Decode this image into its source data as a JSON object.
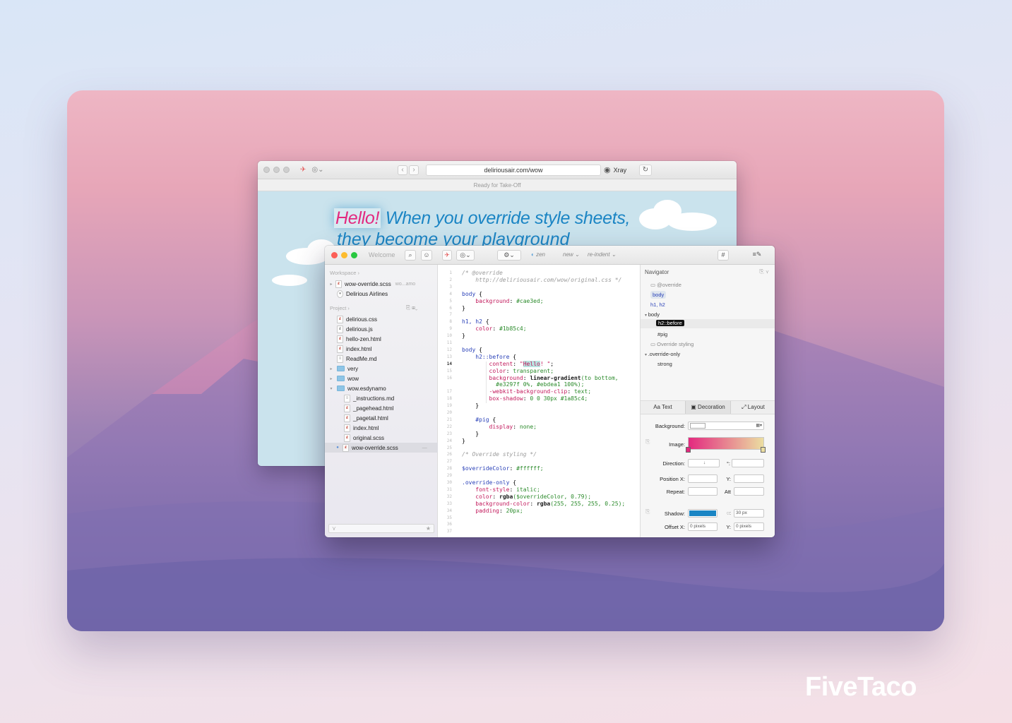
{
  "brand": "FiveTaco",
  "browser": {
    "url": "deliriousair.com/wow",
    "xray_label": "Xray",
    "status": "Ready for Take-Off",
    "headline_highlight": "Hello!",
    "headline_rest": " When you override style sheets,",
    "headline_line2": "they become your playground"
  },
  "editor": {
    "welcome": "Welcome",
    "toolbar": {
      "zen": "zen",
      "new": "new ⌄",
      "reindent": "re-indent ⌄",
      "hash": "#"
    },
    "sidebar": {
      "workspace_header": "Workspace ›",
      "workspace_items": [
        {
          "name": "wow-override.scss",
          "note": "wo...amo"
        },
        {
          "name": "Delirious Airlines",
          "note": ""
        }
      ],
      "project_header": "Project ›",
      "files": [
        "delirious.css",
        "delirious.js",
        "hello-zen.html",
        "index.html",
        "ReadMe.md",
        "very",
        "wow",
        "wow.esdynamo",
        "_instructions.md",
        "_pagehead.html",
        "_pagetail.html",
        "index.html",
        "original.scss",
        "wow-override.scss"
      ]
    },
    "code_lines": [
      "/* @override",
      "    http://deliriousair.com/wow/original.css */",
      "",
      "body {",
      "    background: #cae3ed;",
      "}",
      "",
      "h1, h2 {",
      "    color: #1b85c4;",
      "}",
      "",
      "body {",
      "    h2::before {",
      "        content: \"Hello! \";",
      "        color: transparent;",
      "        background: linear-gradient(to bottom,",
      "          #e3297f 0%, #ebdea1 100%);",
      "        -webkit-background-clip: text;",
      "        box-shadow: 0 0 30px #1a85c4;",
      "    }",
      "",
      "    #pig {",
      "        display: none;",
      "    }",
      "}",
      "",
      "/* Override styling */",
      "",
      "$overrideColor: #ffffff;",
      "",
      ".override-only {",
      "    font-style: italic;",
      "    color: rgba($overrideColor, 0.79);",
      "    background-color: rgba(255, 255, 255, 0.25);",
      "    padding: 20px;"
    ],
    "line_numbers": [
      "1",
      "2",
      "3",
      "4",
      "5",
      "6",
      "7",
      "8",
      "9",
      "10",
      "11",
      "12",
      "13",
      "14",
      "15",
      "16",
      "",
      "17",
      "18",
      "19",
      "20",
      "21",
      "22",
      "23",
      "24",
      "25",
      "26",
      "27",
      "28",
      "29",
      "30",
      "31",
      "32",
      "33",
      "34",
      "35",
      "36",
      "37"
    ],
    "navigator": {
      "title": "Navigator",
      "items": [
        "@override",
        "body",
        "h1, h2",
        "body",
        "h2::before",
        "#pig",
        "Override styling",
        ".override-only",
        "strong"
      ]
    },
    "tabs": [
      "Text",
      "Decoration",
      "Layout"
    ],
    "props": {
      "background": "Background:",
      "image": "Image:",
      "direction": "Direction:",
      "direction_value": "↓",
      "angle_symbol": "°:",
      "position_x": "Position X:",
      "y": "Y:",
      "repeat": "Repeat:",
      "att": "Att",
      "shadow": "Shadow:",
      "shadow_blur": "30 px",
      "offset_x": "Offset X:",
      "offset_x_value": "0 pixels",
      "offset_y_value": "0 pixels"
    },
    "colors": {
      "gradient_start": "#e3297f",
      "gradient_end": "#ebdea1",
      "shadow": "#1a85c4"
    }
  }
}
